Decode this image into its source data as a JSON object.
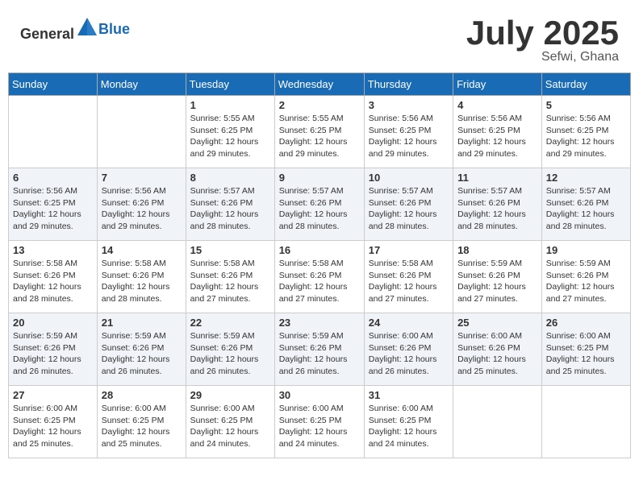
{
  "header": {
    "logo_general": "General",
    "logo_blue": "Blue",
    "month_title": "July 2025",
    "subtitle": "Sefwi, Ghana"
  },
  "days_of_week": [
    "Sunday",
    "Monday",
    "Tuesday",
    "Wednesday",
    "Thursday",
    "Friday",
    "Saturday"
  ],
  "weeks": [
    [
      {
        "day": "",
        "sunrise": "",
        "sunset": "",
        "daylight": ""
      },
      {
        "day": "",
        "sunrise": "",
        "sunset": "",
        "daylight": ""
      },
      {
        "day": "1",
        "sunrise": "Sunrise: 5:55 AM",
        "sunset": "Sunset: 6:25 PM",
        "daylight": "Daylight: 12 hours and 29 minutes."
      },
      {
        "day": "2",
        "sunrise": "Sunrise: 5:55 AM",
        "sunset": "Sunset: 6:25 PM",
        "daylight": "Daylight: 12 hours and 29 minutes."
      },
      {
        "day": "3",
        "sunrise": "Sunrise: 5:56 AM",
        "sunset": "Sunset: 6:25 PM",
        "daylight": "Daylight: 12 hours and 29 minutes."
      },
      {
        "day": "4",
        "sunrise": "Sunrise: 5:56 AM",
        "sunset": "Sunset: 6:25 PM",
        "daylight": "Daylight: 12 hours and 29 minutes."
      },
      {
        "day": "5",
        "sunrise": "Sunrise: 5:56 AM",
        "sunset": "Sunset: 6:25 PM",
        "daylight": "Daylight: 12 hours and 29 minutes."
      }
    ],
    [
      {
        "day": "6",
        "sunrise": "Sunrise: 5:56 AM",
        "sunset": "Sunset: 6:25 PM",
        "daylight": "Daylight: 12 hours and 29 minutes."
      },
      {
        "day": "7",
        "sunrise": "Sunrise: 5:56 AM",
        "sunset": "Sunset: 6:26 PM",
        "daylight": "Daylight: 12 hours and 29 minutes."
      },
      {
        "day": "8",
        "sunrise": "Sunrise: 5:57 AM",
        "sunset": "Sunset: 6:26 PM",
        "daylight": "Daylight: 12 hours and 28 minutes."
      },
      {
        "day": "9",
        "sunrise": "Sunrise: 5:57 AM",
        "sunset": "Sunset: 6:26 PM",
        "daylight": "Daylight: 12 hours and 28 minutes."
      },
      {
        "day": "10",
        "sunrise": "Sunrise: 5:57 AM",
        "sunset": "Sunset: 6:26 PM",
        "daylight": "Daylight: 12 hours and 28 minutes."
      },
      {
        "day": "11",
        "sunrise": "Sunrise: 5:57 AM",
        "sunset": "Sunset: 6:26 PM",
        "daylight": "Daylight: 12 hours and 28 minutes."
      },
      {
        "day": "12",
        "sunrise": "Sunrise: 5:57 AM",
        "sunset": "Sunset: 6:26 PM",
        "daylight": "Daylight: 12 hours and 28 minutes."
      }
    ],
    [
      {
        "day": "13",
        "sunrise": "Sunrise: 5:58 AM",
        "sunset": "Sunset: 6:26 PM",
        "daylight": "Daylight: 12 hours and 28 minutes."
      },
      {
        "day": "14",
        "sunrise": "Sunrise: 5:58 AM",
        "sunset": "Sunset: 6:26 PM",
        "daylight": "Daylight: 12 hours and 28 minutes."
      },
      {
        "day": "15",
        "sunrise": "Sunrise: 5:58 AM",
        "sunset": "Sunset: 6:26 PM",
        "daylight": "Daylight: 12 hours and 27 minutes."
      },
      {
        "day": "16",
        "sunrise": "Sunrise: 5:58 AM",
        "sunset": "Sunset: 6:26 PM",
        "daylight": "Daylight: 12 hours and 27 minutes."
      },
      {
        "day": "17",
        "sunrise": "Sunrise: 5:58 AM",
        "sunset": "Sunset: 6:26 PM",
        "daylight": "Daylight: 12 hours and 27 minutes."
      },
      {
        "day": "18",
        "sunrise": "Sunrise: 5:59 AM",
        "sunset": "Sunset: 6:26 PM",
        "daylight": "Daylight: 12 hours and 27 minutes."
      },
      {
        "day": "19",
        "sunrise": "Sunrise: 5:59 AM",
        "sunset": "Sunset: 6:26 PM",
        "daylight": "Daylight: 12 hours and 27 minutes."
      }
    ],
    [
      {
        "day": "20",
        "sunrise": "Sunrise: 5:59 AM",
        "sunset": "Sunset: 6:26 PM",
        "daylight": "Daylight: 12 hours and 26 minutes."
      },
      {
        "day": "21",
        "sunrise": "Sunrise: 5:59 AM",
        "sunset": "Sunset: 6:26 PM",
        "daylight": "Daylight: 12 hours and 26 minutes."
      },
      {
        "day": "22",
        "sunrise": "Sunrise: 5:59 AM",
        "sunset": "Sunset: 6:26 PM",
        "daylight": "Daylight: 12 hours and 26 minutes."
      },
      {
        "day": "23",
        "sunrise": "Sunrise: 5:59 AM",
        "sunset": "Sunset: 6:26 PM",
        "daylight": "Daylight: 12 hours and 26 minutes."
      },
      {
        "day": "24",
        "sunrise": "Sunrise: 6:00 AM",
        "sunset": "Sunset: 6:26 PM",
        "daylight": "Daylight: 12 hours and 26 minutes."
      },
      {
        "day": "25",
        "sunrise": "Sunrise: 6:00 AM",
        "sunset": "Sunset: 6:26 PM",
        "daylight": "Daylight: 12 hours and 25 minutes."
      },
      {
        "day": "26",
        "sunrise": "Sunrise: 6:00 AM",
        "sunset": "Sunset: 6:25 PM",
        "daylight": "Daylight: 12 hours and 25 minutes."
      }
    ],
    [
      {
        "day": "27",
        "sunrise": "Sunrise: 6:00 AM",
        "sunset": "Sunset: 6:25 PM",
        "daylight": "Daylight: 12 hours and 25 minutes."
      },
      {
        "day": "28",
        "sunrise": "Sunrise: 6:00 AM",
        "sunset": "Sunset: 6:25 PM",
        "daylight": "Daylight: 12 hours and 25 minutes."
      },
      {
        "day": "29",
        "sunrise": "Sunrise: 6:00 AM",
        "sunset": "Sunset: 6:25 PM",
        "daylight": "Daylight: 12 hours and 24 minutes."
      },
      {
        "day": "30",
        "sunrise": "Sunrise: 6:00 AM",
        "sunset": "Sunset: 6:25 PM",
        "daylight": "Daylight: 12 hours and 24 minutes."
      },
      {
        "day": "31",
        "sunrise": "Sunrise: 6:00 AM",
        "sunset": "Sunset: 6:25 PM",
        "daylight": "Daylight: 12 hours and 24 minutes."
      },
      {
        "day": "",
        "sunrise": "",
        "sunset": "",
        "daylight": ""
      },
      {
        "day": "",
        "sunrise": "",
        "sunset": "",
        "daylight": ""
      }
    ]
  ]
}
